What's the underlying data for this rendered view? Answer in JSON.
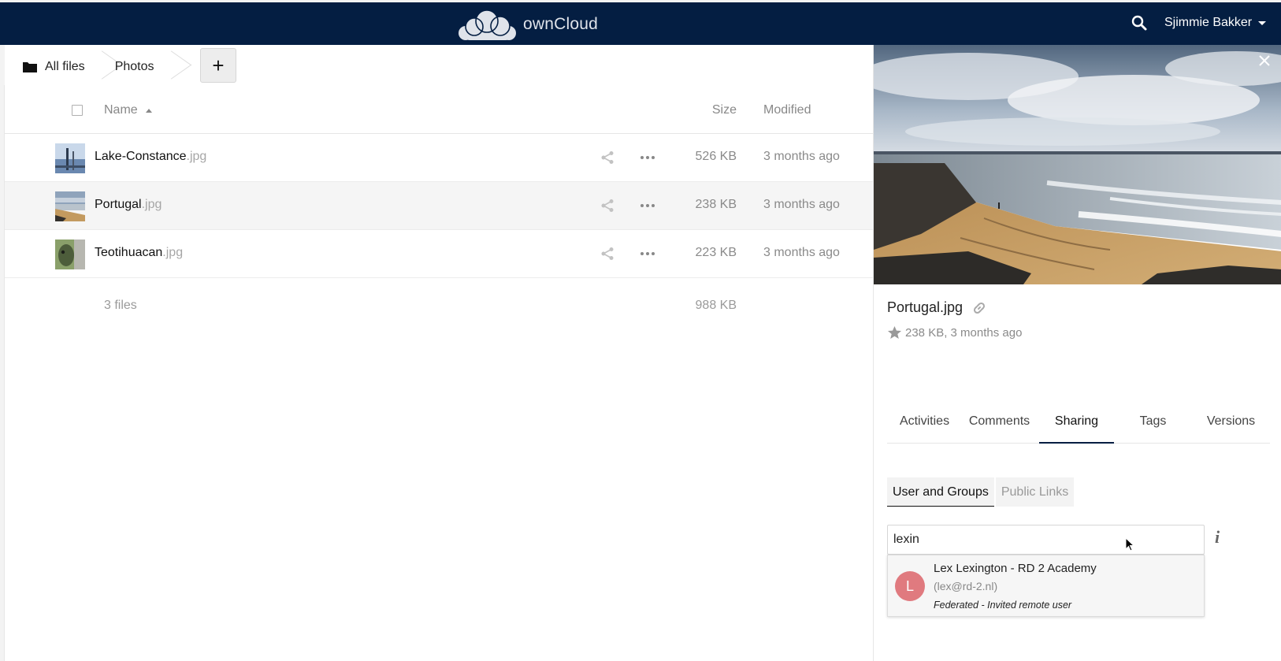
{
  "header": {
    "app_name": "ownCloud",
    "user_name": "Sjimmie Bakker"
  },
  "breadcrumb": {
    "items": [
      "All files",
      "Photos"
    ],
    "new_button": "+"
  },
  "filelist": {
    "columns": {
      "name": "Name",
      "size": "Size",
      "modified": "Modified"
    },
    "files": [
      {
        "name": "Lake-Constance",
        "ext": ".jpg",
        "size": "526 KB",
        "modified": "3 months ago"
      },
      {
        "name": "Portugal",
        "ext": ".jpg",
        "size": "238 KB",
        "modified": "3 months ago"
      },
      {
        "name": "Teotihuacan",
        "ext": ".jpg",
        "size": "223 KB",
        "modified": "3 months ago"
      }
    ],
    "summary": {
      "count": "3 files",
      "size": "988 KB"
    }
  },
  "sidebar": {
    "filename": "Portugal.jpg",
    "meta": "238 KB, 3 months ago",
    "tabs": [
      "Activities",
      "Comments",
      "Sharing",
      "Tags",
      "Versions"
    ],
    "active_tab": "Sharing",
    "subtabs": [
      "User and Groups",
      "Public Links"
    ],
    "share_input_value": "lexin",
    "info_icon": "i",
    "autocomplete": {
      "avatar_letter": "L",
      "name": "Lex Lexington - RD 2 Academy",
      "email": "(lex@rd-2.nl)",
      "type": "Federated - Invited remote user"
    }
  },
  "colors": {
    "header_bg": "#041e42",
    "avatar": "#e07a7f"
  }
}
